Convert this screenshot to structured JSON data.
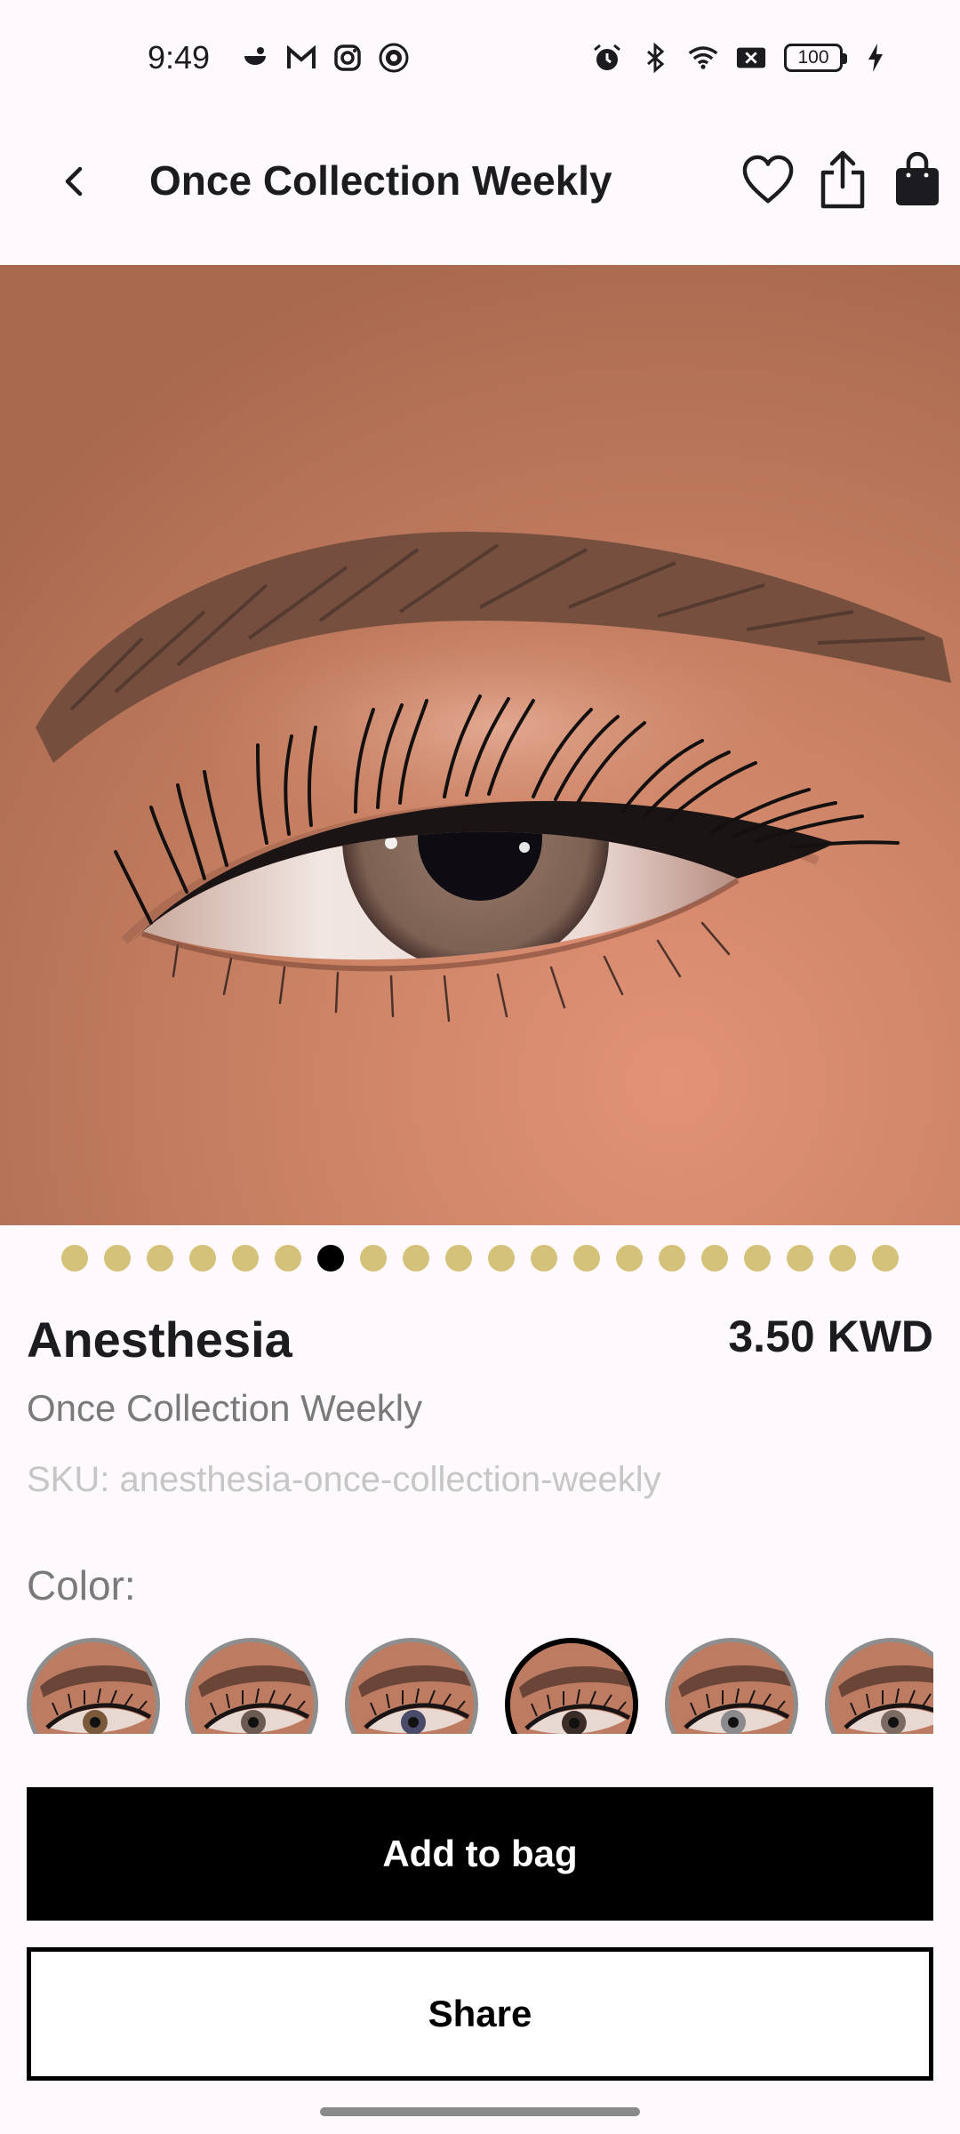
{
  "status_bar": {
    "time": "9:49",
    "battery": "100",
    "left_icons": [
      "notification-icon",
      "gmail-icon",
      "instagram-icon",
      "club-badge-icon"
    ],
    "right_icons": [
      "alarm-icon",
      "bluetooth-icon",
      "wifi-icon",
      "no-signal-icon",
      "battery-icon",
      "charging-icon"
    ]
  },
  "app_bar": {
    "title": "Once Collection Weekly",
    "icons": [
      "back-arrow-icon",
      "heart-icon",
      "share-icon",
      "shopping-bag-icon"
    ]
  },
  "carousel": {
    "total": 20,
    "active_index": 6,
    "dot_color": "#d4c17a",
    "active_color": "#000000"
  },
  "product": {
    "name": "Anesthesia",
    "price": "3.50 KWD",
    "collection": "Once Collection Weekly",
    "sku": "SKU: anesthesia-once-collection-weekly"
  },
  "color_section": {
    "label": "Color:",
    "swatch_count": 6,
    "selected_index": 3
  },
  "actions": {
    "add_to_bag": "Add to bag",
    "share": "Share"
  }
}
